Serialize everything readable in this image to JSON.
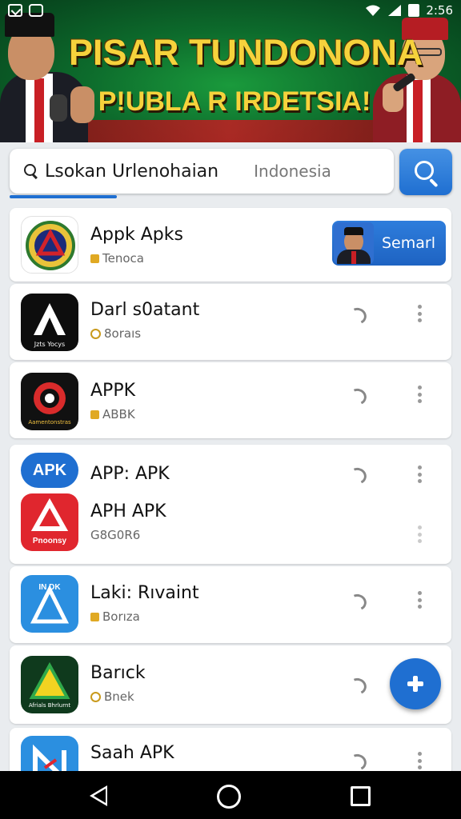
{
  "status_bar": {
    "time": "2:56"
  },
  "banner": {
    "title": "PISAR TUNDONONA",
    "subtitle": "P!UBLA R IRDETSIA!"
  },
  "search": {
    "query": "Lsokan Urlenohaian",
    "placeholder": "Indonesia"
  },
  "apps": [
    {
      "title": "Appk Apks",
      "meta": "Tenoca",
      "action_label": "Semarl",
      "icon": "shield-emblem-icon"
    },
    {
      "title": "Darl s0atant",
      "meta": "8oraıs",
      "icon": "a-letter-icon",
      "icon_text": "Jzts Yocys"
    },
    {
      "title": "APPK",
      "meta": "ABBK",
      "icon": "camera-ring-icon",
      "icon_text": "Aamentonstras"
    },
    {
      "title": "APP: APK",
      "meta": "",
      "icon": "apk-badge-icon",
      "icon_text": "APK"
    },
    {
      "title": "APH APK",
      "meta": "G8G0R6",
      "icon": "a-triangle-icon",
      "icon_text": "Pnoonsy"
    },
    {
      "title": "Laki: Rıvaint",
      "meta": "Borıza",
      "icon": "a-monogram-icon",
      "icon_text": "IN DK"
    },
    {
      "title": "Barıck",
      "meta": "Bnek",
      "icon": "a-green-icon",
      "icon_text": "Afrials Bhrlurnt"
    },
    {
      "title": "Saah APK",
      "meta": "",
      "icon": "n-blue-icon"
    }
  ],
  "colors": {
    "accent": "#1f6fd1",
    "banner_text": "#f6d23c",
    "banner_bg": "#0d6b2c"
  }
}
